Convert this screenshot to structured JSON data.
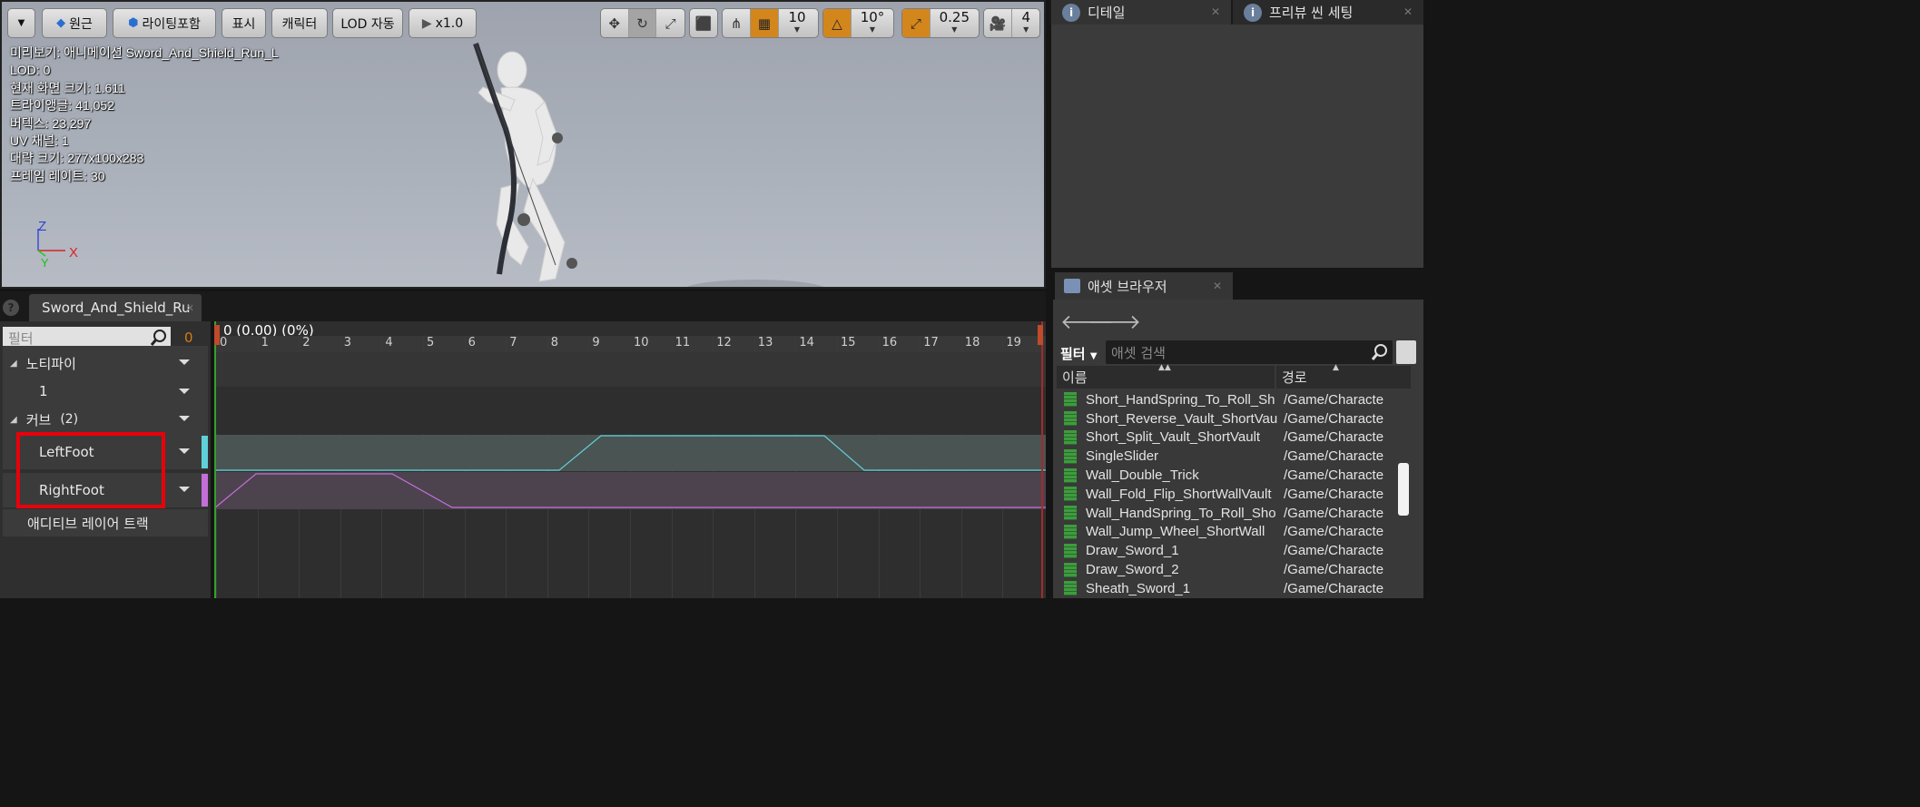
{
  "toolbar": {
    "perspective": "원근",
    "lighting": "라이팅포함",
    "show": "표시",
    "character": "캐릭터",
    "lod": "LOD 자동",
    "playspeed": "x1.0",
    "grid_snap": "10",
    "rotation_snap": "10°",
    "scale_snap": "0.25",
    "camera_speed": "4"
  },
  "viewport": {
    "stats": [
      "미리보기: 애니메이션 Sword_And_Shield_Run_L",
      "LOD: 0",
      "현재 화면 크기: 1.611",
      "트라이앵글: 41,052",
      "버텍스: 23,297",
      "UV 채널: 1",
      "대략 크기: 277x100x283",
      "프레임 레이트: 30"
    ],
    "axis": {
      "z": "Z",
      "x": "X",
      "y": "Y"
    }
  },
  "details": {
    "tab1": "디테일",
    "tab2": "프리뷰 씬 세팅"
  },
  "asset_browser": {
    "tab": "애셋 브라우저",
    "filter": "필터",
    "search_placeholder": "애셋 검색",
    "col_name": "이름",
    "col_path": "경로",
    "rows": [
      {
        "name": "Short_HandSpring_To_Roll_Sh",
        "path": "/Game/Characte"
      },
      {
        "name": "Short_Reverse_Vault_ShortVau",
        "path": "/Game/Characte"
      },
      {
        "name": "Short_Split_Vault_ShortVault",
        "path": "/Game/Characte"
      },
      {
        "name": "SingleSlider",
        "path": "/Game/Characte"
      },
      {
        "name": "Wall_Double_Trick",
        "path": "/Game/Characte"
      },
      {
        "name": "Wall_Fold_Flip_ShortWallVault",
        "path": "/Game/Characte"
      },
      {
        "name": "Wall_HandSpring_To_Roll_Sho",
        "path": "/Game/Characte"
      },
      {
        "name": "Wall_Jump_Wheel_ShortWall",
        "path": "/Game/Characte"
      },
      {
        "name": "Draw_Sword_1",
        "path": "/Game/Characte"
      },
      {
        "name": "Draw_Sword_2",
        "path": "/Game/Characte"
      },
      {
        "name": "Sheath_Sword_1",
        "path": "/Game/Characte"
      }
    ]
  },
  "anim_editor": {
    "tab": "Sword_And_Shield_Ru",
    "filter_placeholder": "필터",
    "filter_count": "0",
    "notify_track": "노티파이",
    "notify_child": "1",
    "curve_track": "커브",
    "curve_count": "(2)",
    "curve1": "LeftFoot",
    "curve2": "RightFoot",
    "additive": "애디티브 레이어 트랙",
    "time": "0 (0.00) (0%)",
    "ticks": [
      "0",
      "1",
      "2",
      "3",
      "4",
      "5",
      "6",
      "7",
      "8",
      "9",
      "10",
      "11",
      "12",
      "13",
      "14",
      "15",
      "16",
      "17",
      "18",
      "19"
    ],
    "curve1_color": "#5fd0d8",
    "curve2_color": "#c46fd8"
  }
}
